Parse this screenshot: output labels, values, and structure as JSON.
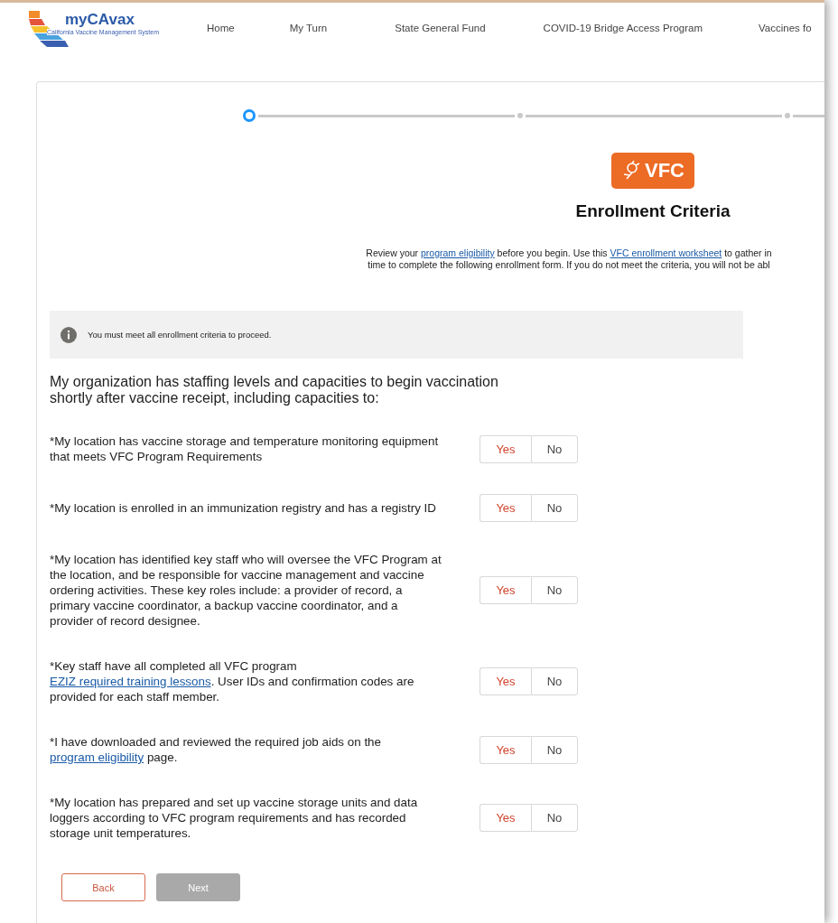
{
  "header": {
    "logo_title": "myCAvax",
    "logo_subtitle": "California Vaccine Management System",
    "nav": [
      {
        "label": "Home"
      },
      {
        "label": "My Turn"
      },
      {
        "label": "State General Fund"
      },
      {
        "label": "COVID-19 Bridge Access Program"
      },
      {
        "label": "Vaccines fo"
      }
    ]
  },
  "stepper": {
    "steps": [
      {
        "selected": true
      },
      {
        "selected": false
      },
      {
        "selected": false
      }
    ]
  },
  "badge": {
    "label": "VFC"
  },
  "title": "Enrollment Criteria",
  "intro_lines": [
    [
      {
        "kind": "text",
        "text": "Review your "
      },
      {
        "kind": "link",
        "text": "program eligibility"
      },
      {
        "kind": "text",
        "text": " before you begin. Use this "
      },
      {
        "kind": "link",
        "text": "VFC enrollment worksheet"
      },
      {
        "kind": "text",
        "text": " to gather in"
      }
    ],
    [
      {
        "kind": "text",
        "text": "time to complete the following enrollment form. If you do not meet the criteria, you will not be abl"
      }
    ]
  ],
  "notice": "You must meet all enrollment criteria to proceed.",
  "question": "My organization has staffing levels and capacities to begin vaccination shortly after vaccine receipt, including capacities to:",
  "criteria": [
    {
      "parts": [
        {
          "kind": "text",
          "text": "*My location has vaccine storage and temperature monitoring equipment that meets VFC Program Requirements"
        }
      ],
      "options": [
        {
          "label": "Yes",
          "selected": false
        },
        {
          "label": "No",
          "selected": false
        }
      ]
    },
    {
      "parts": [
        {
          "kind": "text",
          "text": "*My location is enrolled in an immunization registry and has a registry ID"
        }
      ],
      "options": [
        {
          "label": "Yes",
          "selected": false
        },
        {
          "label": "No",
          "selected": false
        }
      ]
    },
    {
      "parts": [
        {
          "kind": "text",
          "text": "*My location has identified key staff who will oversee the VFC Program at the location, and be responsible for vaccine management and vaccine ordering activities. These key roles include: a provider of record, a primary vaccine coordinator, a backup vaccine coordinator, and a provider of record designee."
        }
      ],
      "options": [
        {
          "label": "Yes",
          "selected": false
        },
        {
          "label": "No",
          "selected": false
        }
      ]
    },
    {
      "parts": [
        {
          "kind": "text",
          "text": "*Key staff have all completed all VFC program "
        },
        {
          "kind": "link",
          "text": "EZIZ required training lessons"
        },
        {
          "kind": "text",
          "text": ". User IDs and confirmation codes are provided for each staff member."
        }
      ],
      "options": [
        {
          "label": "Yes",
          "selected": false
        },
        {
          "label": "No",
          "selected": false
        }
      ]
    },
    {
      "parts": [
        {
          "kind": "text",
          "text": "*I have downloaded and reviewed the required job aids on the "
        },
        {
          "kind": "link",
          "text": "program eligibility"
        },
        {
          "kind": "text",
          "text": " page."
        }
      ],
      "options": [
        {
          "label": "Yes",
          "selected": false
        },
        {
          "label": "No",
          "selected": false
        }
      ]
    },
    {
      "parts": [
        {
          "kind": "text",
          "text": "*My location has prepared and set up vaccine storage units and data loggers according to VFC program requirements and has recorded storage unit temperatures."
        }
      ],
      "options": [
        {
          "label": "Yes",
          "selected": false
        },
        {
          "label": "No",
          "selected": false
        }
      ]
    }
  ],
  "actions": [
    {
      "label": "Back",
      "disabled": false
    },
    {
      "label": "Next",
      "disabled": true
    }
  ]
}
